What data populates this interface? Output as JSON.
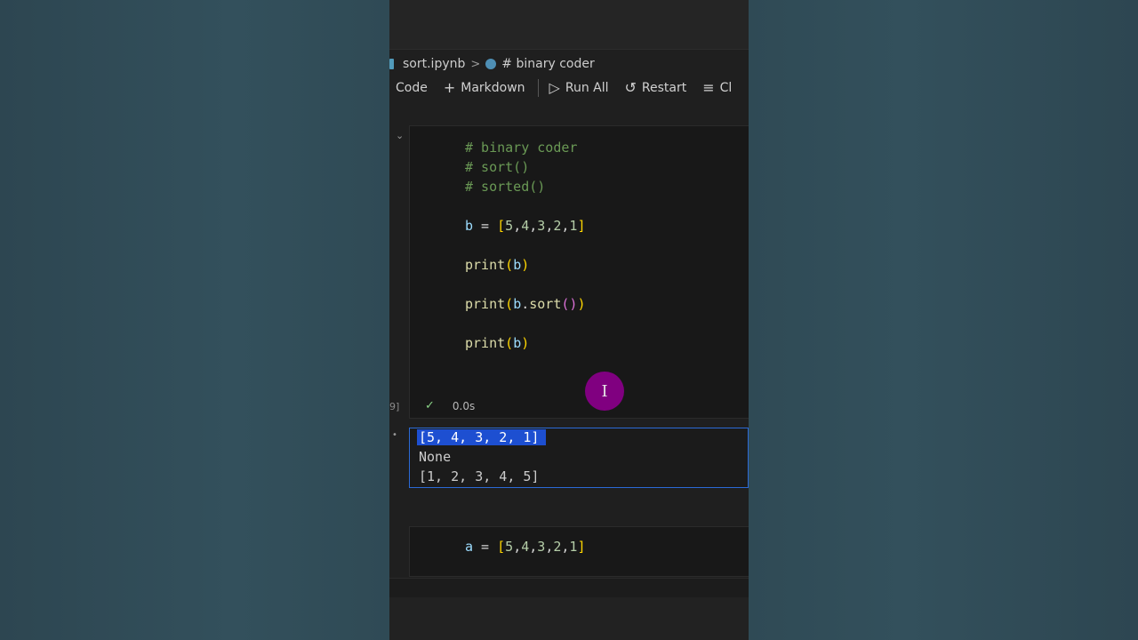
{
  "breadcrumb": {
    "file": "sort.ipynb",
    "separator": ">",
    "cell": "# binary coder"
  },
  "toolbar": {
    "code_label": "Code",
    "markdown_label": "Markdown",
    "run_all_label": "Run All",
    "restart_label": "Restart",
    "clear_label": "Cl",
    "icons": [
      "plus-icon",
      "play-icon",
      "restart-icon",
      "clear-icon"
    ]
  },
  "cell1": {
    "lines": [
      "# binary coder",
      "# sort()",
      "# sorted()",
      "b = [5,4,3,2,1]",
      "print(b)",
      "print(b.sort())",
      "print(b)"
    ],
    "execution_count": "9]",
    "duration": "0.0s"
  },
  "output": {
    "lines": [
      "[5, 4, 3, 2, 1]",
      "None",
      "[1, 2, 3, 4, 5]"
    ]
  },
  "cell2": {
    "line": "a = [5,4,3,2,1]"
  },
  "colors": {
    "accent_selection": "#1d4fd1",
    "output_border": "#2b6ad6",
    "cursor_highlight": "#800080",
    "check": "#89d185"
  }
}
